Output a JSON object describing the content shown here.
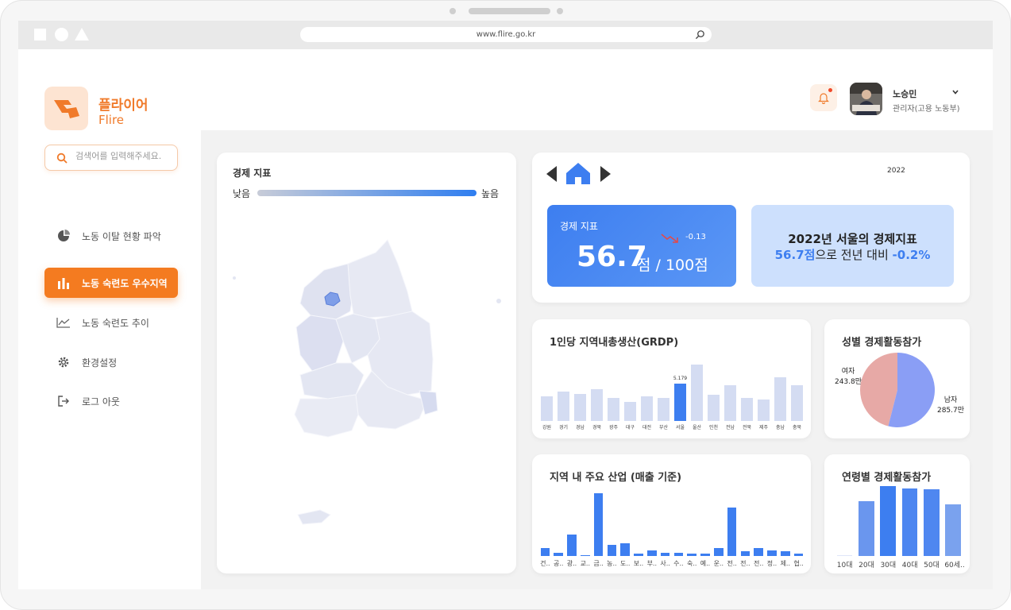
{
  "browser": {
    "url": "www.flire.go.kr"
  },
  "brand": {
    "name": "플라이어",
    "sub": "Flire"
  },
  "search": {
    "placeholder": "검색어를 입력해주세요."
  },
  "nav": [
    {
      "label": "노동 이탈 현황 파악",
      "icon": "pie-chart-icon"
    },
    {
      "label": "노동 숙련도 우수지역",
      "icon": "bar-chart-icon",
      "active": true
    },
    {
      "label": "노동 숙련도 추이",
      "icon": "line-chart-icon"
    },
    {
      "label": "환경설정",
      "icon": "gear-icon"
    },
    {
      "label": "로그 아웃",
      "icon": "logout-icon"
    }
  ],
  "user": {
    "name": "노승민",
    "role": "관리자(고용 노동부)"
  },
  "map_card": {
    "title": "경제 지표",
    "low": "낮음",
    "high": "높음"
  },
  "kpi": {
    "year": "2022",
    "label": "경제 지표",
    "delta": "-0.13",
    "value": "56.7",
    "suffix": "점 / 100점",
    "summary_line1": "2022년 서울의 경제지표",
    "summary_value": "56.7점",
    "summary_mid": "으로 전년 대비 ",
    "summary_delta": "-0.2%"
  },
  "grdp": {
    "title": "1인당 지역내총생산(GRDP)"
  },
  "gender": {
    "title": "성별 경제활동참가",
    "female_label": "여자",
    "female_value": "243.8만",
    "male_label": "남자",
    "male_value": "285.7만"
  },
  "industry": {
    "title": "지역 내 주요 산업 (매출 기준)"
  },
  "age": {
    "title": "연령별 경제활동참가"
  },
  "colors": {
    "accent": "#f47b20",
    "blue": "#3d7ef0",
    "light_blue": "#d4dcf2"
  },
  "chart_data": [
    {
      "type": "bar",
      "title": "1인당 지역내총생산(GRDP)",
      "categories": [
        "강원",
        "경기",
        "경남",
        "경북",
        "광주",
        "대구",
        "대전",
        "부산",
        "서울",
        "울산",
        "인천",
        "전남",
        "전북",
        "제주",
        "충남",
        "충북"
      ],
      "values": [
        3.4,
        4.1,
        3.7,
        4.4,
        3.2,
        2.6,
        3.4,
        3.2,
        5.179,
        7.8,
        3.6,
        4.9,
        3.2,
        3.0,
        6.0,
        4.9
      ],
      "highlight": "서울",
      "data_labels": {
        "서울": "5.179"
      },
      "ylim": [
        0,
        9
      ]
    },
    {
      "type": "bar",
      "title": "지역 내 주요 산업 (매출 기준)",
      "categories": [
        "건..",
        "공..",
        "광..",
        "교..",
        "금..",
        "농..",
        "도..",
        "보..",
        "부..",
        "사..",
        "수..",
        "숙..",
        "예..",
        "운..",
        "전..",
        "전..",
        "전..",
        "정..",
        "제..",
        "협.."
      ],
      "values": [
        7,
        3,
        19,
        1,
        56,
        10,
        11,
        2,
        5,
        3,
        3,
        2,
        2,
        7,
        43,
        4,
        7,
        5,
        4,
        2
      ],
      "ylim": [
        0,
        60
      ]
    },
    {
      "type": "pie",
      "title": "성별 경제활동참가",
      "labels": [
        "여자",
        "남자"
      ],
      "values": [
        243.8,
        285.7
      ]
    },
    {
      "type": "bar",
      "title": "연령별 경제활동참가",
      "categories": [
        "10대",
        "20대",
        "30대",
        "40대",
        "50대",
        "60세.."
      ],
      "values": [
        1,
        73,
        93,
        89,
        88,
        68
      ],
      "ylim": [
        0,
        100
      ]
    }
  ]
}
